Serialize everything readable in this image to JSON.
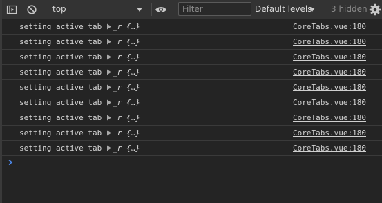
{
  "toolbar": {
    "context": "top",
    "filter_placeholder": "Filter",
    "levels": "Default levels",
    "hidden_count": "3 hidden"
  },
  "console": {
    "rows": [
      {
        "message": "setting active tab",
        "object": "_r {…}",
        "source": "CoreTabs.vue:180"
      },
      {
        "message": "setting active tab",
        "object": "_r {…}",
        "source": "CoreTabs.vue:180"
      },
      {
        "message": "setting active tab",
        "object": "_r {…}",
        "source": "CoreTabs.vue:180"
      },
      {
        "message": "setting active tab",
        "object": "_r {…}",
        "source": "CoreTabs.vue:180"
      },
      {
        "message": "setting active tab",
        "object": "_r {…}",
        "source": "CoreTabs.vue:180"
      },
      {
        "message": "setting active tab",
        "object": "_r {…}",
        "source": "CoreTabs.vue:180"
      },
      {
        "message": "setting active tab",
        "object": "_r {…}",
        "source": "CoreTabs.vue:180"
      },
      {
        "message": "setting active tab",
        "object": "_r {…}",
        "source": "CoreTabs.vue:180"
      },
      {
        "message": "setting active tab",
        "object": "_r {…}",
        "source": "CoreTabs.vue:180"
      }
    ]
  },
  "icons": {
    "sidebar_toggle": "sidebar-toggle-icon",
    "clear": "clear-console-icon",
    "context_dropdown": "triangle-down-icon",
    "live_expression": "eye-icon",
    "levels_dropdown": "triangle-down-icon",
    "settings": "gear-icon",
    "expand": "triangle-right-icon",
    "prompt": "chevron-right-icon"
  },
  "colors": {
    "background": "#242424",
    "toolbar": "#333333",
    "text": "#d5d5d5",
    "muted": "#8a8a8a",
    "prompt": "#4e8cf2"
  }
}
